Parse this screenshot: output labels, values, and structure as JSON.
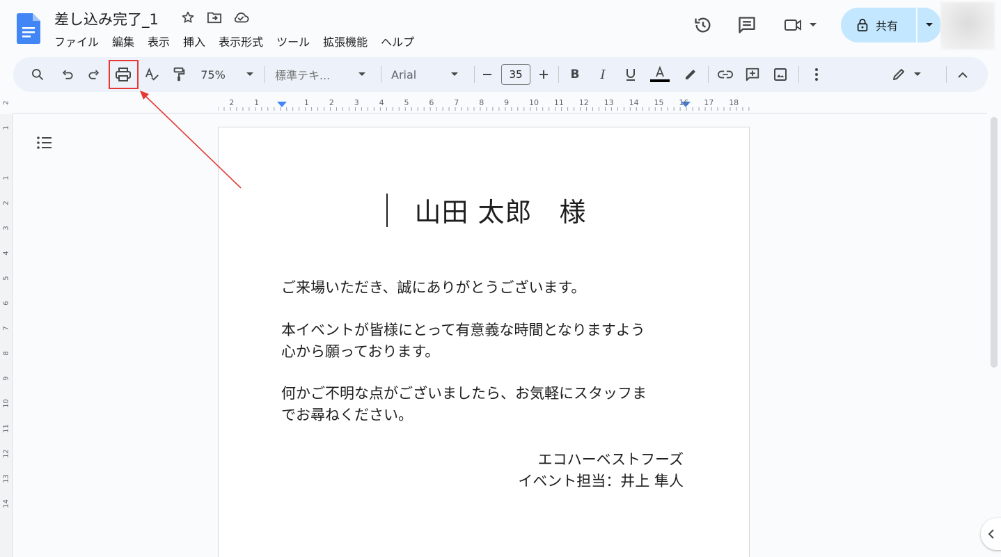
{
  "document": {
    "title": "差し込み完了_1"
  },
  "menubar": [
    "ファイル",
    "編集",
    "表示",
    "挿入",
    "表示形式",
    "ツール",
    "拡張機能",
    "ヘルプ"
  ],
  "header": {
    "share_label": "共有"
  },
  "toolbar": {
    "zoom": "75%",
    "style": "標準テキ...",
    "font": "Arial",
    "font_size": "35",
    "text_color": "#000000"
  },
  "ruler": {
    "horizontal": [
      "2",
      "1",
      "1",
      "2",
      "3",
      "4",
      "5",
      "6",
      "7",
      "8",
      "9",
      "10",
      "11",
      "12",
      "13",
      "14",
      "15",
      "16",
      "17",
      "18"
    ],
    "vertical": [
      "2",
      "1",
      "1",
      "2",
      "3",
      "4",
      "5",
      "6",
      "7",
      "8",
      "9",
      "10",
      "11",
      "12",
      "13",
      "14"
    ]
  },
  "content": {
    "heading": "山田 太郎　様",
    "paragraphs": [
      [
        "ご来場いただき、誠にありがとうございます。"
      ],
      [
        "本イベントが皆様にとって有意義な時間となりますよう",
        "心から願っております。"
      ],
      [
        "何かご不明な点がございましたら、お気軽にスタッフま",
        "でお尋ねください。"
      ]
    ],
    "signature": [
      "エコハーベストフーズ",
      "イベント担当：井上 隼人"
    ]
  },
  "annotation": {
    "highlight_color": "#e53935"
  }
}
